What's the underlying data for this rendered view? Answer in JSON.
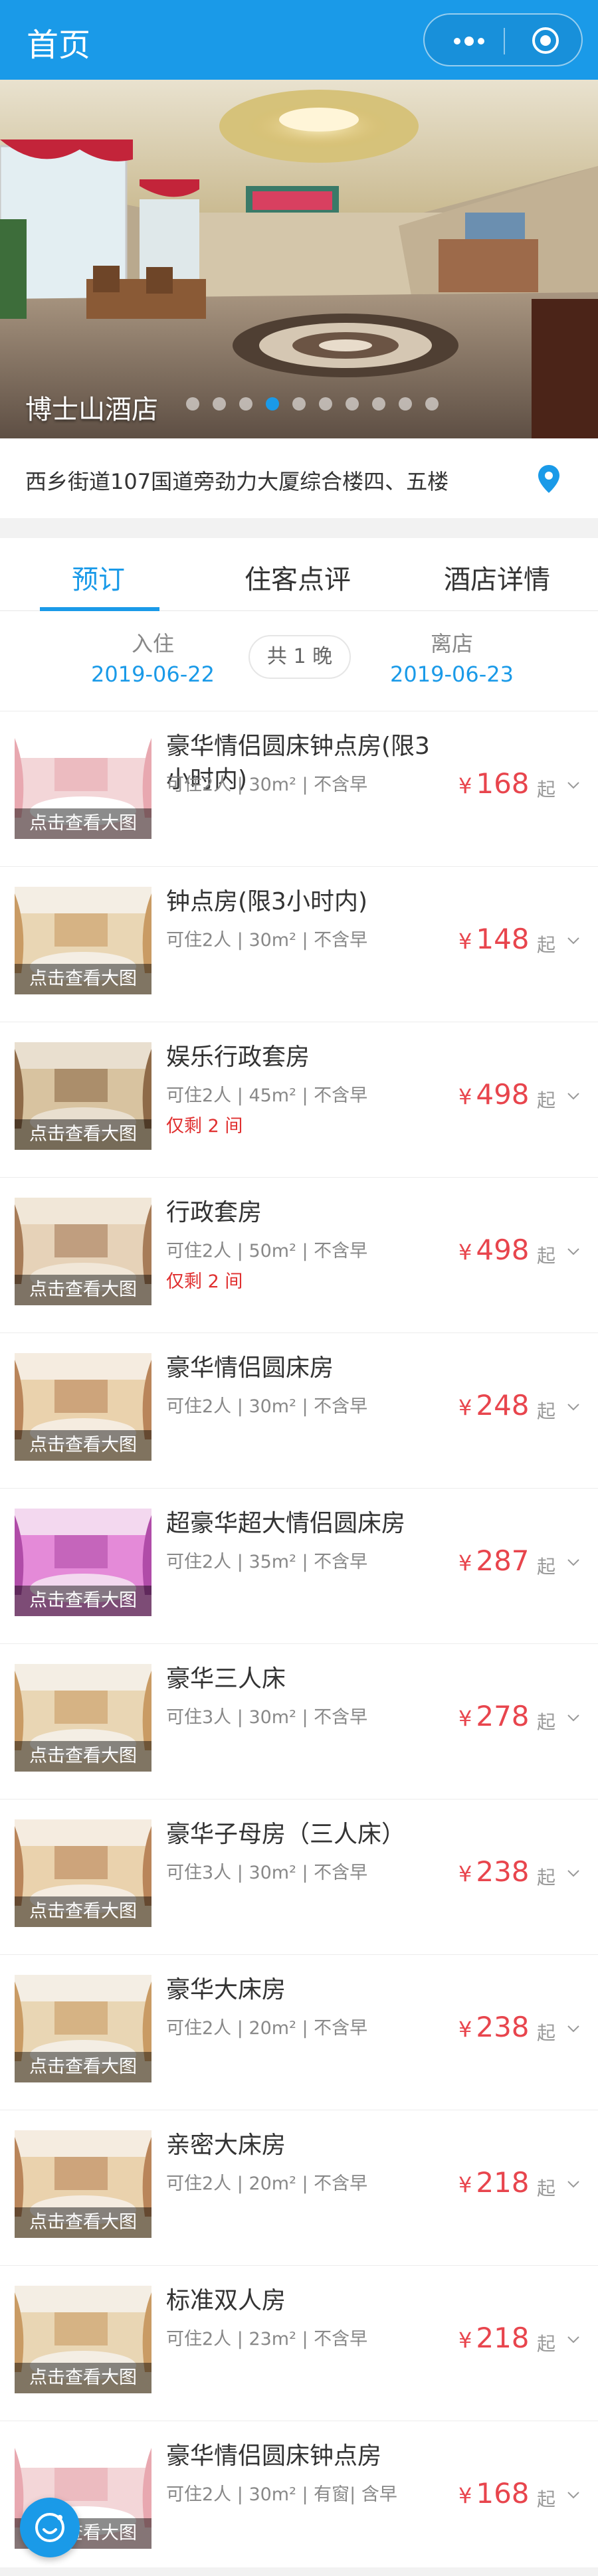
{
  "topbar": {
    "title": "首页",
    "more_icon": "more-dots-icon",
    "close_icon": "target-close-icon"
  },
  "hero": {
    "hotel_name": "博士山酒店",
    "slide_count": 10,
    "active_slide": 3
  },
  "address": {
    "text": "西乡街道107国道旁劲力大厦综合楼四、五楼",
    "icon": "location-pin-icon"
  },
  "tabs": [
    {
      "label": "预订",
      "active": true
    },
    {
      "label": "住客点评",
      "active": false
    },
    {
      "label": "酒店详情",
      "active": false
    }
  ],
  "dates": {
    "checkin_label": "入住",
    "checkin_date": "2019-06-22",
    "nights": "共 1 晚",
    "checkout_label": "离店",
    "checkout_date": "2019-06-23"
  },
  "room_caption": "点击查看大图",
  "currency": "¥",
  "qi": "起",
  "rooms": [
    {
      "name": "豪华情侣圆床钟点房(限3小时内)",
      "info": "可住2人 | 30m² | 不含早",
      "price": "168",
      "left": "",
      "photo": "pink"
    },
    {
      "name": "钟点房(限3小时内)",
      "info": "可住2人 | 30m² | 不含早",
      "price": "148",
      "left": "",
      "photo": "warm"
    },
    {
      "name": "娱乐行政套房",
      "info": "可住2人 | 45m² | 不含早",
      "price": "498",
      "left": "仅剩 2 间",
      "photo": "suite"
    },
    {
      "name": "行政套房",
      "info": "可住2人 | 50m² | 不含早",
      "price": "498",
      "left": "仅剩 2 间",
      "photo": "suite2"
    },
    {
      "name": "豪华情侣圆床房",
      "info": "可住2人 | 30m² | 不含早",
      "price": "248",
      "left": "",
      "photo": "warm2"
    },
    {
      "name": "超豪华超大情侣圆床房",
      "info": "可住2人 | 35m² | 不含早",
      "price": "287",
      "left": "",
      "photo": "magenta"
    },
    {
      "name": "豪华三人床",
      "info": "可住3人 | 30m² | 不含早",
      "price": "278",
      "left": "",
      "photo": "warm"
    },
    {
      "name": "豪华子母房（三人床）",
      "info": "可住3人 | 30m² | 不含早",
      "price": "238",
      "left": "",
      "photo": "warm2"
    },
    {
      "name": "豪华大床房",
      "info": "可住2人 | 20m² | 不含早",
      "price": "238",
      "left": "",
      "photo": "warm"
    },
    {
      "name": "亲密大床房",
      "info": "可住2人 | 20m² | 不含早",
      "price": "218",
      "left": "",
      "photo": "warm2"
    },
    {
      "name": "标准双人房",
      "info": "可住2人 | 23m² | 不含早",
      "price": "218",
      "left": "",
      "photo": "warm"
    },
    {
      "name": "豪华情侣圆床钟点房",
      "info": "可住2人 | 30m² | 有窗| 含早",
      "price": "168",
      "left": "",
      "photo": "pink"
    }
  ],
  "fab_icon": "contact-service-icon",
  "colors": {
    "accent": "#1a9ae8",
    "price": "#e8454d",
    "warning": "#e03030"
  }
}
